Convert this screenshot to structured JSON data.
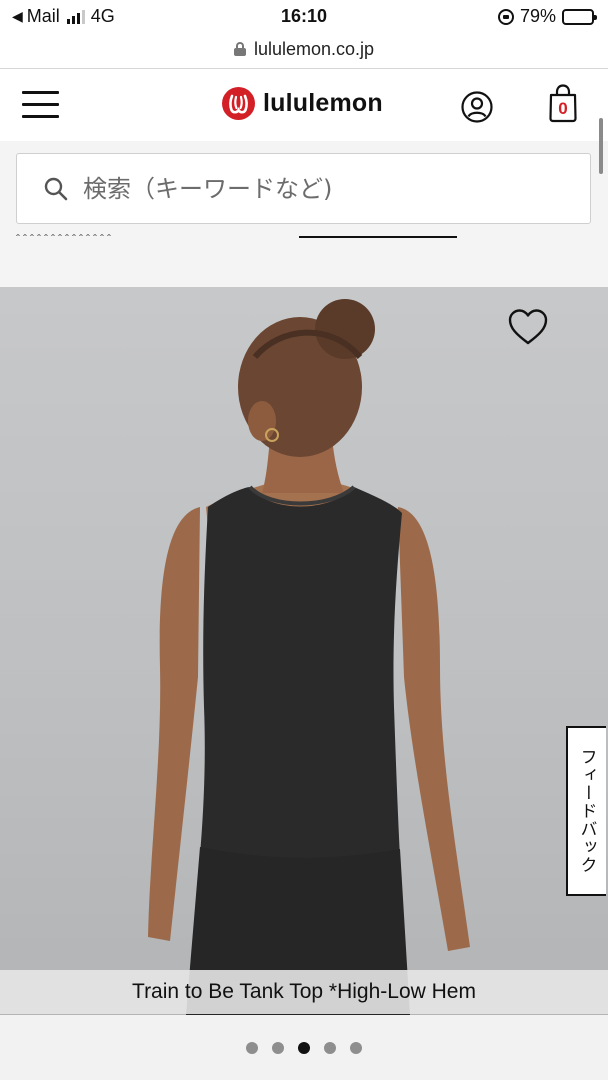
{
  "status_bar": {
    "back_app": "Mail",
    "network": "4G",
    "time": "16:10",
    "battery_percent": "79%",
    "battery_level": 0.79
  },
  "browser": {
    "url": "lululemon.co.jp"
  },
  "header": {
    "logo_text": "lululemon",
    "brand_color": "#d31f26",
    "cart_count": "0",
    "icons": [
      "menu-icon",
      "account-icon",
      "shopping-bag-icon"
    ]
  },
  "search": {
    "placeholder": "検索（キーワードなど)"
  },
  "product": {
    "caption": "Train to Be Tank Top *High-Low Hem",
    "feedback_label": "フィードバック",
    "wishlist_icon": "heart-icon"
  },
  "carousel": {
    "total": 5,
    "active_index": 2
  }
}
